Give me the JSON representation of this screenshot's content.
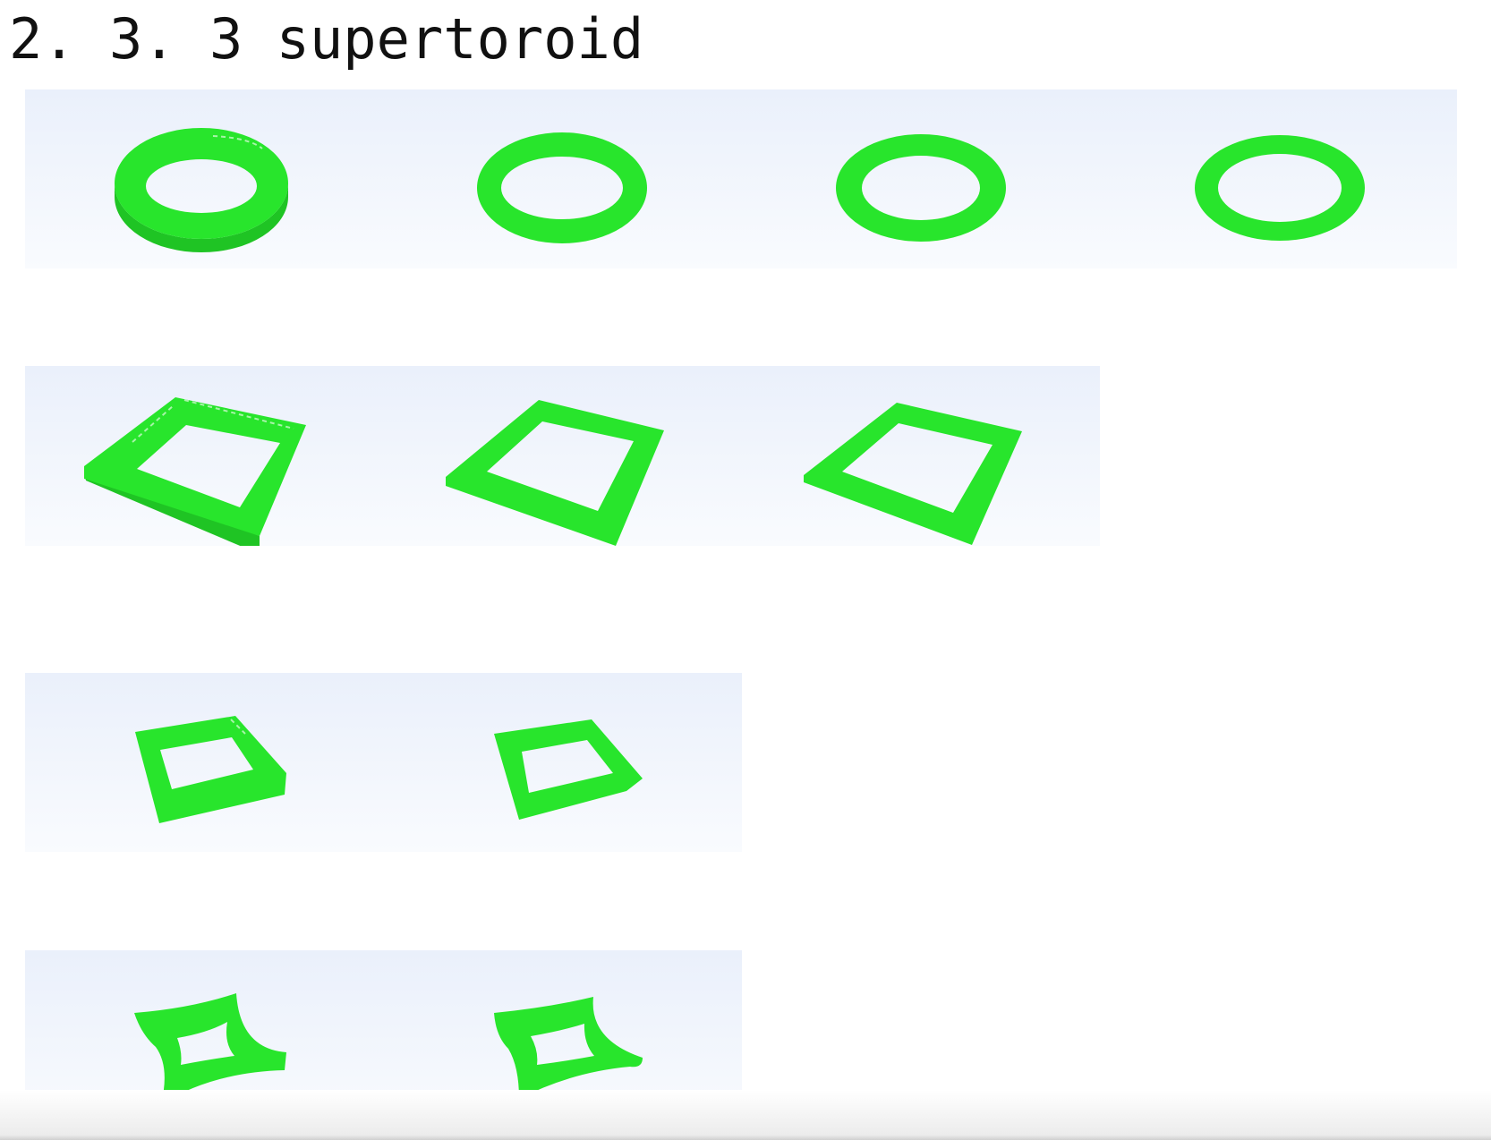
{
  "section": {
    "title": "2. 3. 3 supertoroid"
  },
  "figure": {
    "shape_color": "#28e52c",
    "panel_background": "#edf2fb",
    "rows": [
      {
        "shape": "circular-ring",
        "count": 4
      },
      {
        "shape": "square-ring",
        "count": 3
      },
      {
        "shape": "small-square-ring",
        "count": 2
      },
      {
        "shape": "astroid-ring",
        "count": 2
      }
    ]
  }
}
